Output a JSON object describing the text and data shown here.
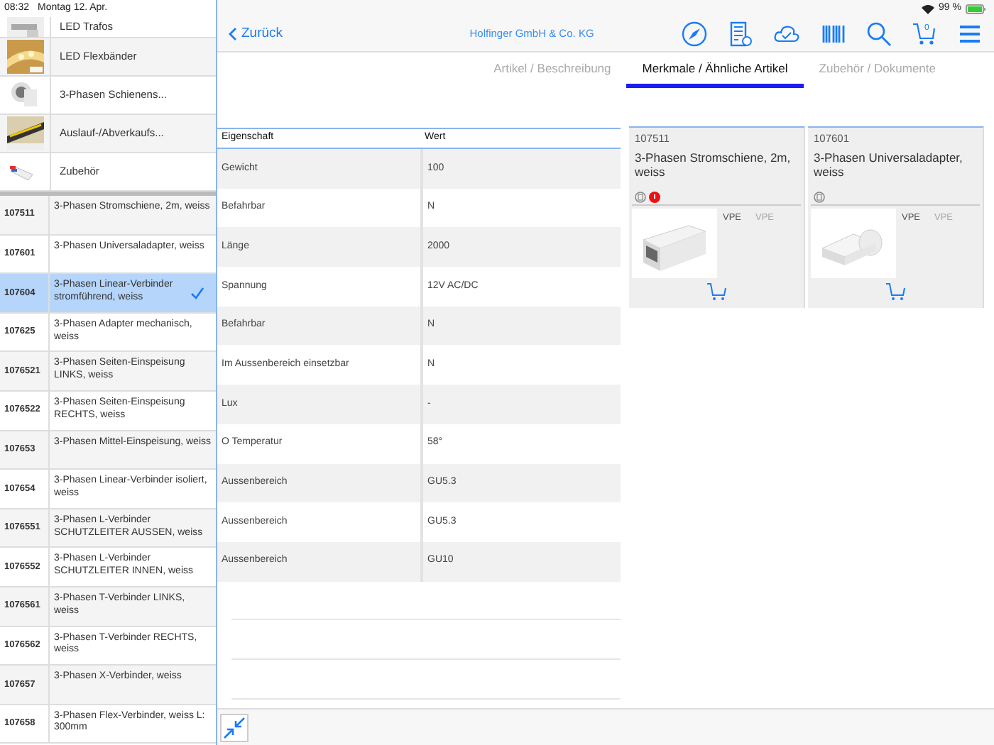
{
  "status_bar": {
    "time": "08:32",
    "date": "Montag 12. Apr.",
    "battery": "99 %"
  },
  "categories": [
    {
      "label": "LED Trafos"
    },
    {
      "label": "LED Flexbänder"
    },
    {
      "label": "3-Phasen Schienens..."
    },
    {
      "label": "Auslauf-/Abverkaufs..."
    },
    {
      "label": "Zubehör"
    }
  ],
  "articles": [
    {
      "number": "107511",
      "name": "3-Phasen Stromschiene, 2m, weiss",
      "selected": false
    },
    {
      "number": "107601",
      "name": "3-Phasen Universaladapter, weiss",
      "selected": false
    },
    {
      "number": "107604",
      "name": "3-Phasen Linear-Verbinder stromführend, weiss",
      "selected": true
    },
    {
      "number": "107625",
      "name": "3-Phasen Adapter mechanisch, weiss",
      "selected": false
    },
    {
      "number": "1076521",
      "name": "3-Phasen Seiten-Einspeisung LINKS, weiss",
      "selected": false
    },
    {
      "number": "1076522",
      "name": "3-Phasen Seiten-Einspeisung RECHTS, weiss",
      "selected": false
    },
    {
      "number": "107653",
      "name": "3-Phasen Mittel-Einspeisung, weiss",
      "selected": false
    },
    {
      "number": "107654",
      "name": "3-Phasen Linear-Verbinder isoliert, weiss",
      "selected": false
    },
    {
      "number": "1076551",
      "name": "3-Phasen L-Verbinder SCHUTZLEITER AUSSEN, weiss",
      "selected": false
    },
    {
      "number": "1076552",
      "name": "3-Phasen L-Verbinder SCHUTZLEITER INNEN, weiss",
      "selected": false
    },
    {
      "number": "1076561",
      "name": "3-Phasen T-Verbinder LINKS, weiss",
      "selected": false
    },
    {
      "number": "1076562",
      "name": "3-Phasen T-Verbinder RECHTS, weiss",
      "selected": false
    },
    {
      "number": "107657",
      "name": "3-Phasen X-Verbinder, weiss",
      "selected": false
    },
    {
      "number": "107658",
      "name": "3-Phasen Flex-Verbinder, weiss L: 300mm",
      "selected": false
    }
  ],
  "nav": {
    "back": "Zurück",
    "title": "Holfinger GmbH & Co. KG",
    "cart_count": "0"
  },
  "tabs": [
    {
      "label": "Artikel / Beschreibung",
      "selected": false
    },
    {
      "label": "Merkmale / Ähnliche Artikel",
      "selected": true
    },
    {
      "label": "Zubehör / Dokumente",
      "selected": false
    }
  ],
  "table": {
    "columns": [
      "Eigenschaft",
      "Wert"
    ],
    "rows": [
      [
        "Gewicht",
        "100"
      ],
      [
        "Befahrbar",
        "N"
      ],
      [
        "Länge",
        "2000"
      ],
      [
        "Spannung",
        "12V AC/DC"
      ],
      [
        "Befahrbar",
        "N"
      ],
      [
        "Im Aussenbereich einsetzbar",
        "N"
      ],
      [
        "Lux",
        "-"
      ],
      [
        "O Temperatur",
        "58°"
      ],
      [
        "Aussenbereich",
        "GU5.3"
      ],
      [
        "Aussenbereich",
        "GU5.3"
      ],
      [
        "Aussenbereich",
        "GU10"
      ]
    ]
  },
  "similar": [
    {
      "number": "107511",
      "name": "3-Phasen Stromschiene, 2m, weiss",
      "flagged": true,
      "vpe": [
        {
          "label": "VPE",
          "disabled": false
        },
        {
          "label": "VPE",
          "disabled": true
        }
      ]
    },
    {
      "number": "107601",
      "name": "3-Phasen Universaladapter, weiss",
      "flagged": false,
      "vpe": [
        {
          "label": "VPE",
          "disabled": false
        },
        {
          "label": "VPE",
          "disabled": true
        }
      ]
    }
  ]
}
